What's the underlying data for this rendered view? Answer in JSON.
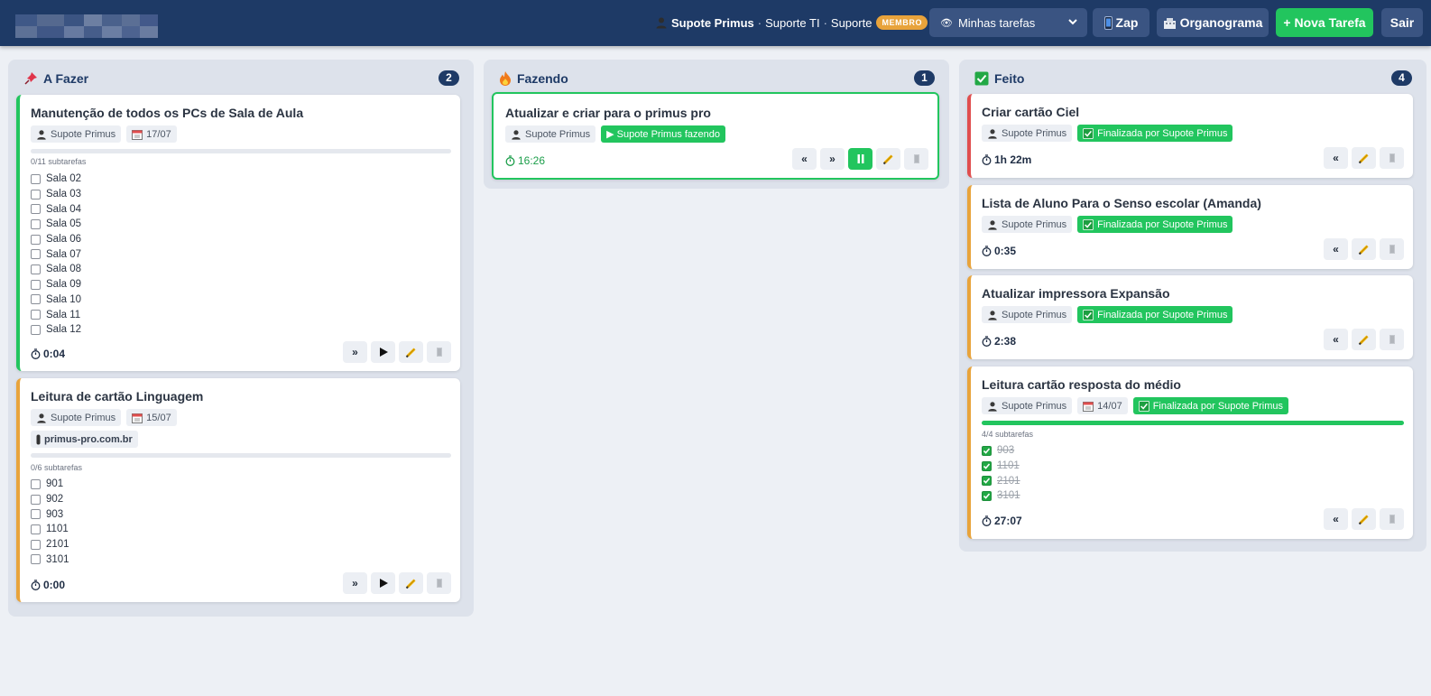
{
  "header": {
    "user_name": "Supote Primus",
    "separator": "·",
    "department": "Suporte TI",
    "area": "Suporte",
    "role_badge": "MEMBRO",
    "filter_selected": "Minhas tarefas",
    "zap_label": "Zap",
    "org_label": "Organograma",
    "new_task_label": "+ Nova Tarefa",
    "logout_label": "Sair"
  },
  "columns": {
    "todo": {
      "title": "A Fazer",
      "count": "2"
    },
    "doing": {
      "title": "Fazendo",
      "count": "1"
    },
    "done": {
      "title": "Feito",
      "count": "4"
    }
  },
  "todo_cards": [
    {
      "title": "Manutenção de todos os PCs de Sala de Aula",
      "assignee": "Supote Primus",
      "date": "17/07",
      "progress": 0,
      "subtasks_label": "0/11 subtarefas",
      "subtasks": [
        "Sala 02",
        "Sala 03",
        "Sala 04",
        "Sala 05",
        "Sala 06",
        "Sala 07",
        "Sala 08",
        "Sala 09",
        "Sala 10",
        "Sala 11",
        "Sala 12"
      ],
      "timer": "0:04"
    },
    {
      "title": "Leitura de cartão Linguagem",
      "assignee": "Supote Primus",
      "date": "15/07",
      "link": "primus-pro.com.br",
      "progress": 0,
      "subtasks_label": "0/6 subtarefas",
      "subtasks": [
        "901",
        "902",
        "903",
        "1101",
        "2101",
        "3101"
      ],
      "timer": "0:00"
    }
  ],
  "doing_cards": [
    {
      "title": "Atualizar e criar para o primus pro",
      "assignee": "Supote Primus",
      "status": "▶ Supote Primus fazendo",
      "timer": "16:26"
    }
  ],
  "done_cards": [
    {
      "title": "Criar cartão Ciel",
      "assignee": "Supote Primus",
      "status": "Finalizada por Supote Primus",
      "timer": "1h 22m"
    },
    {
      "title": "Lista de Aluno Para o Senso escolar (Amanda)",
      "assignee": "Supote Primus",
      "status": "Finalizada por Supote Primus",
      "timer": "0:35"
    },
    {
      "title": "Atualizar impressora Expansão",
      "assignee": "Supote Primus",
      "status": "Finalizada por Supote Primus",
      "timer": "2:38"
    },
    {
      "title": "Leitura cartão resposta do médio",
      "assignee": "Supote Primus",
      "date": "14/07",
      "status": "Finalizada por Supote Primus",
      "progress": 1,
      "subtasks_label": "4/4 subtarefas",
      "subtasks": [
        "903",
        "1101",
        "2101",
        "3101"
      ],
      "timer": "27:07"
    }
  ],
  "actions": {
    "forward": "»",
    "back": "«"
  },
  "colors": {
    "header": "#1e3a66",
    "green": "#22c55e",
    "orange": "#e8a33b",
    "red": "#e04e4e"
  }
}
